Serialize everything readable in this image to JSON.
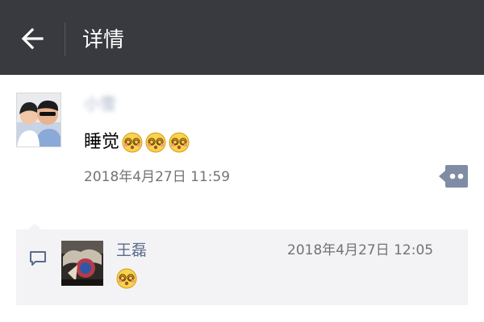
{
  "header": {
    "title": "详情"
  },
  "post": {
    "author_name": "小雪",
    "text": "睡觉",
    "emoji_count": 3,
    "timestamp": "2018年4月27日 11:59"
  },
  "comment": {
    "author_name": "王磊",
    "timestamp": "2018年4月27日 12:05",
    "emoji_count": 1
  },
  "colors": {
    "topbar": "#393a3f",
    "link_name": "#5b6b8d",
    "timestamp": "#737373",
    "comments_bg": "#f3f3f5",
    "more_button": "#7f8ca5"
  }
}
